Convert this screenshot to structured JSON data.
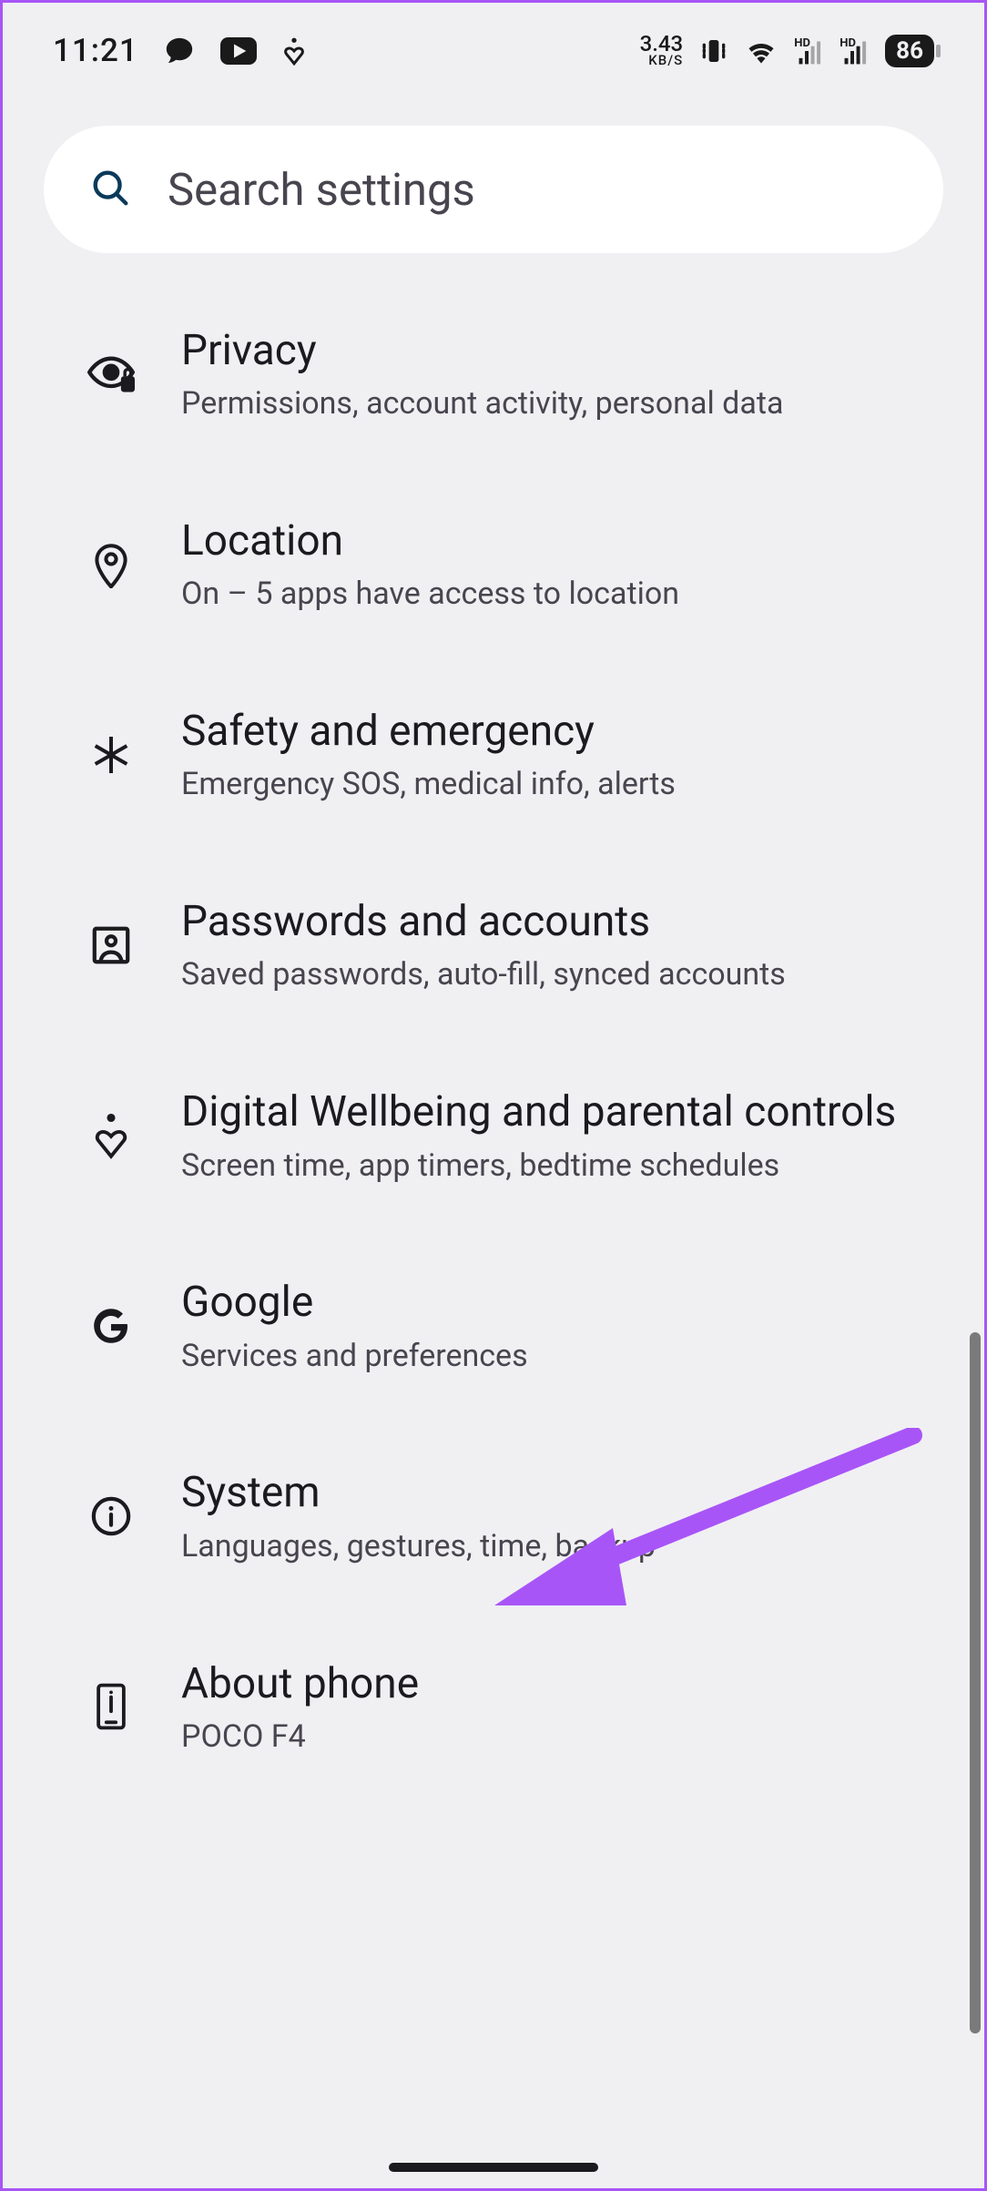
{
  "status_bar": {
    "time": "11:21",
    "net_speed_value": "3.43",
    "net_speed_unit": "KB/S",
    "battery_percent": "86"
  },
  "search": {
    "placeholder": "Search settings"
  },
  "settings": [
    {
      "key": "privacy",
      "title": "Privacy",
      "subtitle": "Permissions, account activity, personal data"
    },
    {
      "key": "location",
      "title": "Location",
      "subtitle": "On – 5 apps have access to location"
    },
    {
      "key": "safety",
      "title": "Safety and emergency",
      "subtitle": "Emergency SOS, medical info, alerts"
    },
    {
      "key": "passwords",
      "title": "Passwords and accounts",
      "subtitle": "Saved passwords, auto-fill, synced accounts"
    },
    {
      "key": "wellbeing",
      "title": "Digital Wellbeing and parental controls",
      "subtitle": "Screen time, app timers, bedtime schedules"
    },
    {
      "key": "google",
      "title": "Google",
      "subtitle": "Services and preferences"
    },
    {
      "key": "system",
      "title": "System",
      "subtitle": "Languages, gestures, time, backup"
    },
    {
      "key": "about",
      "title": "About phone",
      "subtitle": "POCO F4"
    }
  ],
  "annotation": {
    "points_to": "google",
    "color": "#a855f7"
  }
}
